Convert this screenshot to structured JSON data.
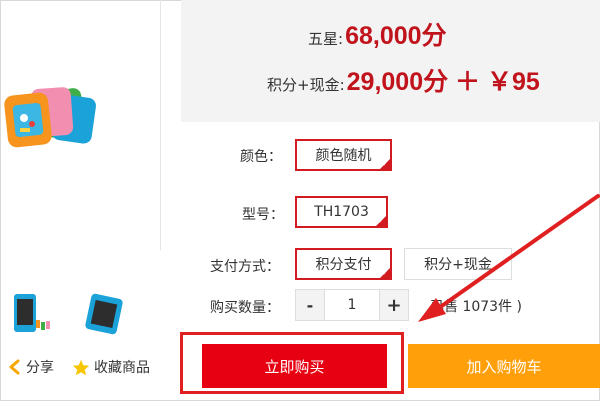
{
  "price": {
    "five_star_label": "五星",
    "five_star_value": "68,000分",
    "combo_label": "积分+现金",
    "combo_value": "29,000分 ＋ ￥95",
    "separator": ":"
  },
  "options": {
    "color_label": "颜色：",
    "color_value": "颜色随机",
    "model_label": "型号：",
    "model_value": "TH1703",
    "payment_label": "支付方式：",
    "payment_selected": "积分支付",
    "payment_other": "积分+现金",
    "quantity_label": "购买数量：",
    "quantity_value": "1",
    "minus": "-",
    "plus": "+",
    "sold_info": "已售 1073件 )"
  },
  "actions": {
    "buy_now": "立即购买",
    "add_to_cart": "加入购物车",
    "share": "分享",
    "favorite": "收藏商品"
  },
  "icons": {
    "share": "share-icon",
    "favorite": "star-icon",
    "check": "check-icon"
  },
  "colors": {
    "accent_red": "#e60012",
    "price_red": "#c0131b",
    "cart_orange": "#ff9f0a",
    "annotation_red": "#e02020"
  }
}
